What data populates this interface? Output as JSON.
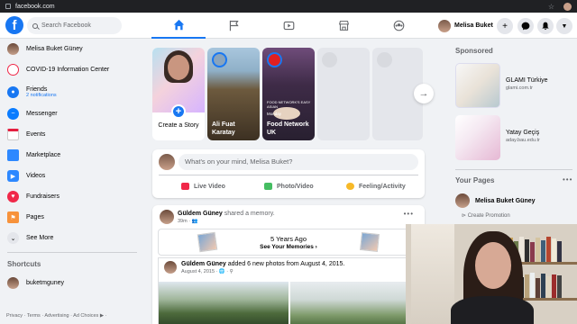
{
  "browser": {
    "url": "facebook.com"
  },
  "topnav": {
    "search_placeholder": "Search Facebook",
    "user_name": "Melisa Buket"
  },
  "sidebar": {
    "items": [
      {
        "label": "Melisa Buket Güney",
        "icon": "avatar"
      },
      {
        "label": "COVID-19 Information Center",
        "icon": "covid-icon"
      },
      {
        "label": "Friends",
        "sub": "2 notifications",
        "icon": "friends-icon"
      },
      {
        "label": "Messenger",
        "icon": "messenger-icon"
      },
      {
        "label": "Events",
        "icon": "events-icon"
      },
      {
        "label": "Marketplace",
        "icon": "marketplace-icon"
      },
      {
        "label": "Videos",
        "icon": "videos-icon"
      },
      {
        "label": "Fundraisers",
        "icon": "fundraisers-icon"
      },
      {
        "label": "Pages",
        "icon": "pages-icon"
      },
      {
        "label": "See More",
        "icon": "chevron-down-icon"
      }
    ],
    "shortcuts_title": "Shortcuts",
    "shortcuts": [
      {
        "label": "buketmguney"
      }
    ],
    "footer": "Privacy · Terms · Advertising · Ad Choices ▶ ·"
  },
  "stories": {
    "create_label": "Create a Story",
    "items": [
      {
        "name": "Ali Fuat Karatay"
      },
      {
        "name": "Food Network UK",
        "overlay_title": "FOOD NETWORK'S EASY ASIAN",
        "overlay_sub": "Monday"
      }
    ]
  },
  "composer": {
    "placeholder": "What's on your mind, Melisa Buket?",
    "live_video": "Live Video",
    "photo_video": "Photo/Video",
    "feeling": "Feeling/Activity"
  },
  "post": {
    "author": "Güldem Güney",
    "action": "shared a memory.",
    "time": "39m",
    "memory_title": "5 Years Ago",
    "memory_link": "See Your Memories ›",
    "inner_author": "Güldem Güney",
    "inner_action": "added 6 new photos from August 4, 2015.",
    "inner_time": "August 4, 2015"
  },
  "right": {
    "sponsored_title": "Sponsored",
    "ads": [
      {
        "title": "GLAMI Türkiye",
        "domain": "glami.com.tr"
      },
      {
        "title": "Yatay Geçiş",
        "domain": "aday.bau.edu.tr"
      }
    ],
    "pages_title": "Your Pages",
    "page_name": "Melisa Buket Güney",
    "promo": "Create Promotion"
  },
  "colors": {
    "brand": "#1877f2",
    "bg": "#f0f2f5"
  }
}
